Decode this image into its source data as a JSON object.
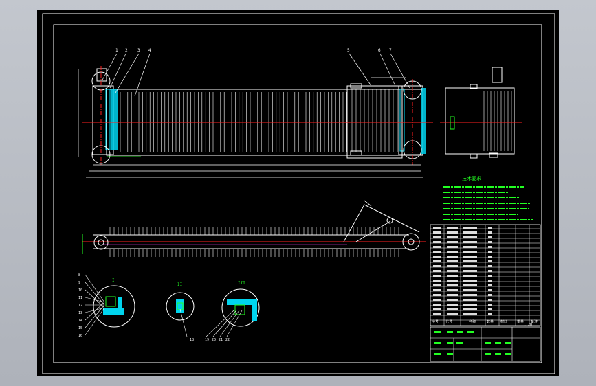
{
  "drawing": {
    "background_color": "#000000",
    "frame_color": "#ffffff",
    "part_color": "#ffffff",
    "cyan": "#00e5ff",
    "red": "#ff2020",
    "green": "#22ff22",
    "magenta": "#ff40ff"
  },
  "top_view": {
    "callouts": [
      "1",
      "2",
      "3",
      "4",
      "5",
      "6",
      "7"
    ]
  },
  "tech_requirements": {
    "title": "技术要求"
  },
  "detail_views": {
    "labels": [
      "I",
      "II",
      "III"
    ],
    "callouts_left": [
      "8",
      "9",
      "10",
      "11",
      "12",
      "13",
      "14",
      "15",
      "16"
    ],
    "callouts_mid": [
      "18"
    ],
    "callouts_right": [
      "19",
      "20",
      "21",
      "22"
    ]
  },
  "bom": {
    "header": [
      "序号",
      "代号",
      "名称",
      "数量",
      "材料",
      "重量",
      "备注"
    ]
  },
  "title_block": {
    "scale": "1:20"
  }
}
